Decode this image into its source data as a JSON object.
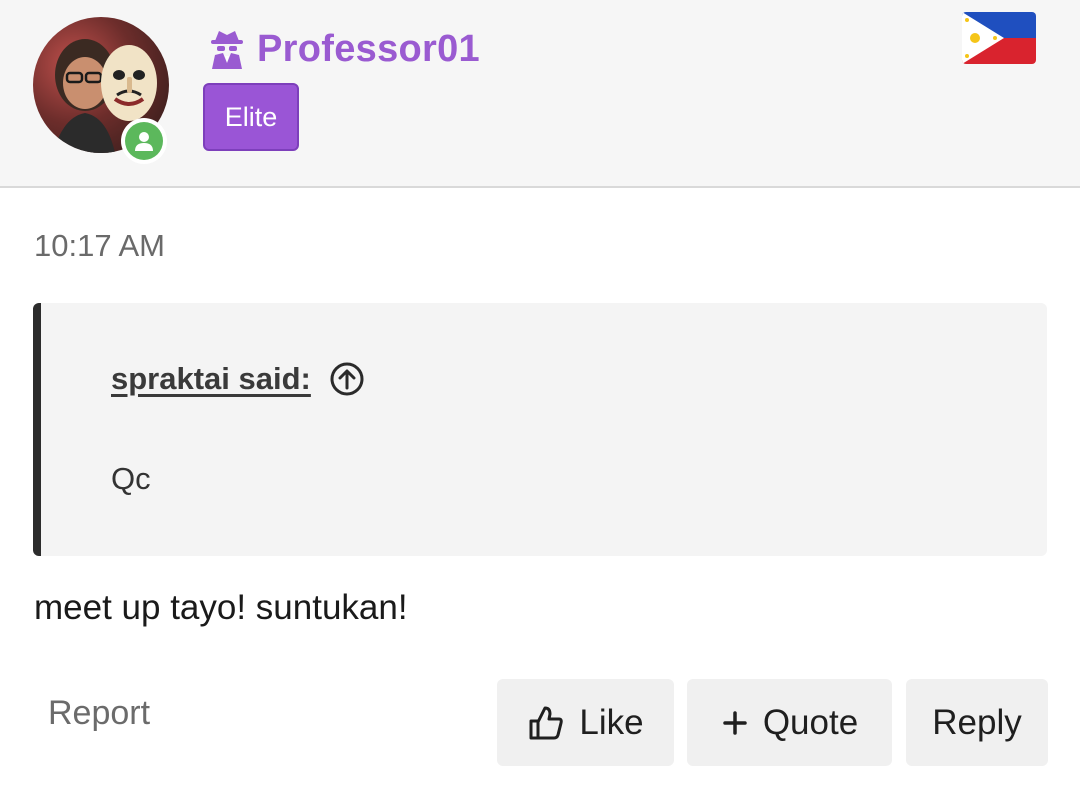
{
  "author": {
    "username": "Professor01",
    "badge": "Elite",
    "status_icon": "user-online-icon",
    "role_icon": "spy-icon",
    "country_flag": "philippines-flag-icon"
  },
  "post": {
    "timestamp": "10:17 AM",
    "quote": {
      "author_label": "spraktai said:",
      "jump_icon": "arrow-up-circle-icon",
      "text": "Qc"
    },
    "message": "meet up tayo! suntukan!"
  },
  "actions": {
    "report_label": "Report",
    "like_label": "Like",
    "like_icon": "thumbs-up-icon",
    "quote_label": "Quote",
    "quote_icon": "plus-icon",
    "reply_label": "Reply"
  },
  "colors": {
    "username": "#9a5bd1",
    "badge_bg": "#9a55d6",
    "online": "#5cb85c",
    "quote_bar": "#2c2c2c"
  }
}
